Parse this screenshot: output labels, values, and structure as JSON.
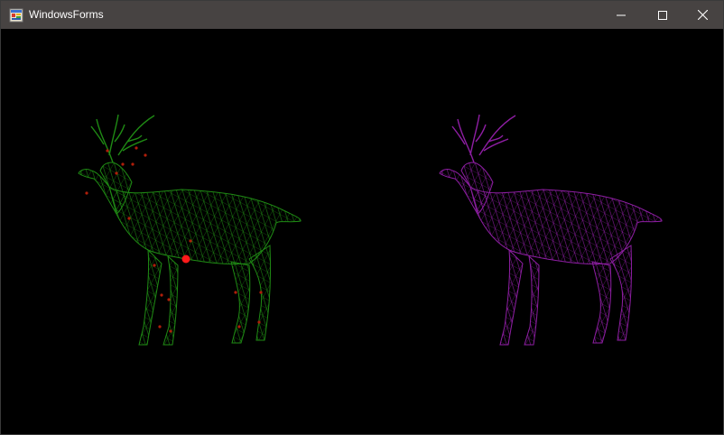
{
  "window": {
    "title": "WindowsForms",
    "icon": "windows-forms-app-icon",
    "controls": [
      "minimize-icon",
      "maximize-icon",
      "close-icon"
    ]
  },
  "canvas": {
    "background": "#000000",
    "models": [
      {
        "name": "deer-wireframe-left",
        "wire_color": "#1f8a14",
        "vertex_color": "#b01e0a"
      },
      {
        "name": "deer-wireframe-right",
        "wire_color": "#8e1ea3"
      }
    ],
    "selected_vertex_color": "#ff1a1a"
  }
}
